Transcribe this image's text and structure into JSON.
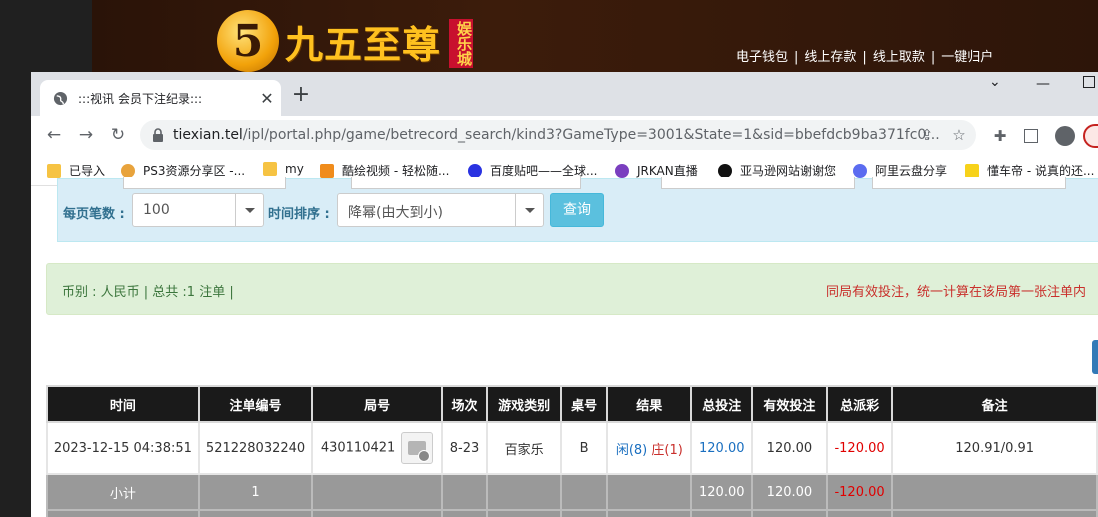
{
  "site": {
    "logo_char": "5",
    "logo_text": "九五至尊",
    "logo_tag": "娱乐城",
    "links": [
      "电子钱包",
      "线上存款",
      "线上取款",
      "一键归户"
    ]
  },
  "browser": {
    "tab_title": ":::视讯 会员下注纪录:::",
    "url_host": "tiexian.tel",
    "url_path": "/ipl/portal.php/game/betrecord_search/kind3?GameType=3001&State=1&sid=bbefdcb9ba371fc0...",
    "bookmarks": [
      {
        "label": "已导入",
        "color": "#f6c343"
      },
      {
        "label": "PS3资源分享区 -...",
        "color": "#e8a33c"
      },
      {
        "label": "my",
        "color": "#f6c343"
      },
      {
        "label": "酷绘视频 - 轻松随...",
        "color": "#f08c1c"
      },
      {
        "label": "百度贴吧——全球...",
        "color": "#2932e1"
      },
      {
        "label": "JRKAN直播",
        "color": "#7a3fbf"
      },
      {
        "label": "亚马逊网站谢谢您",
        "color": "#111111"
      },
      {
        "label": "阿里云盘分享",
        "color": "#5b6cf0"
      },
      {
        "label": "懂车帝 - 说真的还...",
        "color": "#f7d21a"
      }
    ]
  },
  "filters": {
    "page_size_label": "每页笔数 :",
    "page_size_value": "100",
    "sort_label": "时间排序 :",
    "sort_value": "降幂(由大到小)",
    "query_button": "查询"
  },
  "summary": {
    "left": "币别 : 人民币 | 总共 :1 注单 |",
    "right": "同局有效投注，统一计算在该局第一张注单内"
  },
  "table": {
    "headers": [
      "时间",
      "注单编号",
      "局号",
      "场次",
      "游戏类别",
      "桌号",
      "结果",
      "总投注",
      "有效投注",
      "总派彩",
      "备注"
    ],
    "rows": [
      {
        "time": "2023-12-15 04:38:51",
        "bet_no": "521228032240",
        "round_no": "430110421",
        "session": "8-23",
        "game": "百家乐",
        "table": "B",
        "result_xian": "闲(8)",
        "result_zhuang": "庄(1)",
        "total_bet": "120.00",
        "valid_bet": "120.00",
        "payout": "-120.00",
        "note": "120.91/0.91"
      }
    ],
    "subtotal": {
      "label": "小计",
      "count": "1",
      "total_bet": "120.00",
      "valid_bet": "120.00",
      "payout": "-120.00"
    }
  },
  "colors": {
    "accent_blue": "#1a6fc0",
    "negative_red": "#e00000",
    "query_button": "#5bc0de"
  }
}
